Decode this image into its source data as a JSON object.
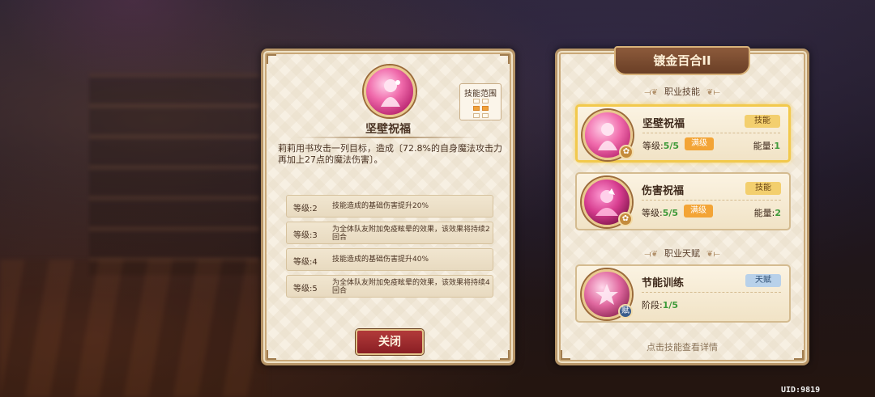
{
  "skill_detail": {
    "title": "坚壁祝福",
    "range_label": "技能范围",
    "description": "莉莉用书攻击一列目标，造成〔72.8%的自身魔法攻击力再加上27点的魔法伤害〕。",
    "levels": [
      {
        "label": "等级:2",
        "text": "技能造成的基础伤害提升20%"
      },
      {
        "label": "等级:3",
        "text": "为全体队友附加免疫眩晕的效果，该效果将持续2回合"
      },
      {
        "label": "等级:4",
        "text": "技能造成的基础伤害提升40%"
      },
      {
        "label": "等级:5",
        "text": "为全体队友附加免疫眩晕的效果，该效果将持续4回合"
      }
    ],
    "close_label": "关闭"
  },
  "class_panel": {
    "title": "镀金百合II",
    "skills_section": "职业技能",
    "talent_section": "职业天赋",
    "skills": [
      {
        "name": "坚壁祝福",
        "tag": "技能",
        "level_label": "等级:",
        "level": "5/5",
        "max_label": "满级",
        "energy_label": "能量:",
        "energy": "1",
        "badge": "✿"
      },
      {
        "name": "伤害祝福",
        "tag": "技能",
        "level_label": "等级:",
        "level": "5/5",
        "max_label": "满级",
        "energy_label": "能量:",
        "energy": "2",
        "badge": "✿"
      }
    ],
    "talent": {
      "name": "节能训练",
      "tag": "天赋",
      "stage_label": "阶段:",
      "stage": "1/5",
      "badge": "赋"
    },
    "hint": "点击技能查看详情"
  },
  "uid": "UID:9819",
  "colors": {
    "accent_gold": "#f2c94c",
    "close_red": "#8a1f24",
    "level_green": "#3f9a3a"
  }
}
